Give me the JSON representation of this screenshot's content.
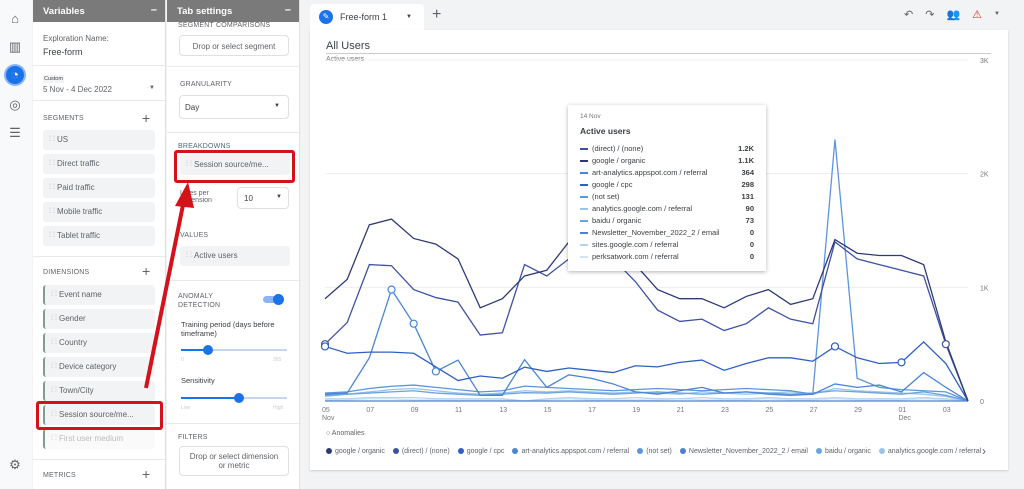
{
  "rail": {
    "icons": [
      "home-icon",
      "reports-icon",
      "explore-icon",
      "advertising-icon",
      "configure-icon",
      "settings-icon"
    ]
  },
  "variables": {
    "title": "Variables",
    "exploration_label": "Exploration Name:",
    "exploration_name": "Free-form",
    "date_tag": "Custom",
    "date_range": "5 Nov - 4 Dec 2022",
    "segments_label": "SEGMENTS",
    "segments": [
      "US",
      "Direct traffic",
      "Paid traffic",
      "Mobile traffic",
      "Tablet traffic"
    ],
    "dimensions_label": "DIMENSIONS",
    "dimensions": [
      "Event name",
      "Gender",
      "Country",
      "Device category",
      "Town/City",
      "Session source/me...",
      "First user medium"
    ],
    "metrics_label": "METRICS"
  },
  "tab_settings": {
    "title": "Tab settings",
    "segment_comparisons": "SEGMENT COMPARISONS",
    "segment_drop": "Drop or select segment",
    "granularity_label": "GRANULARITY",
    "granularity": "Day",
    "breakdowns_label": "BREAKDOWNS",
    "breakdown": "Session source/me...",
    "lines_label": "Lines per dimension",
    "lines": "10",
    "values_label": "VALUES",
    "value": "Active users",
    "anomaly_label": "ANOMALY DETECTION",
    "anomaly_on": true,
    "training_label": "Training period (days before timeframe)",
    "training_min": "0",
    "training_max": "365",
    "training_value": 0.25,
    "sensitivity_label": "Sensitivity",
    "sens_min": "Low",
    "sens_max": "High",
    "sensitivity_value": 0.55,
    "filters_label": "FILTERS",
    "filters_drop": "Drop or select dimension or metric"
  },
  "tabs": {
    "active": "Free-form 1",
    "add": "+"
  },
  "toolbar": {
    "icons": [
      "undo-icon",
      "redo-icon",
      "share-icon",
      "warning-icon"
    ]
  },
  "card": {
    "title": "All Users",
    "metric": "Active users",
    "anomalies": "Anomalies",
    "next": "›"
  },
  "tooltip": {
    "date": "14 Nov",
    "title": "Active users",
    "rows": [
      {
        "label": "(direct) / (none)",
        "value": "1.2K",
        "color": "#3f51a3"
      },
      {
        "label": "google / organic",
        "value": "1.1K",
        "color": "#2e3a78"
      },
      {
        "label": "art-analytics.appspot.com / referral",
        "value": "364",
        "color": "#4a85d6"
      },
      {
        "label": "google / cpc",
        "value": "298",
        "color": "#2f5fc4"
      },
      {
        "label": "(not set)",
        "value": "131",
        "color": "#5b95e0"
      },
      {
        "label": "analytics.google.com / referral",
        "value": "90",
        "color": "#9ac4e8"
      },
      {
        "label": "baidu / organic",
        "value": "73",
        "color": "#6aa4dc"
      },
      {
        "label": "Newsletter_November_2022_2 / email",
        "value": "0",
        "color": "#4f7fd0"
      },
      {
        "label": "sites.google.com / referral",
        "value": "0",
        "color": "#b5d3ee"
      },
      {
        "label": "perksatwork.com / referral",
        "value": "0",
        "color": "#d3e4f5"
      }
    ]
  },
  "chart_data": {
    "type": "line",
    "ylim": [
      0,
      3000
    ],
    "y_ticks": [
      "0",
      "1K",
      "2K",
      "3K"
    ],
    "x_ticks": [
      "05\nNov",
      "07",
      "09",
      "11",
      "13",
      "15",
      "17",
      "19",
      "21",
      "23",
      "25",
      "27",
      "29",
      "01\nDec",
      "03"
    ],
    "x": [
      "5 Nov",
      "6 Nov",
      "7 Nov",
      "8 Nov",
      "9 Nov",
      "10 Nov",
      "11 Nov",
      "12 Nov",
      "13 Nov",
      "14 Nov",
      "15 Nov",
      "16 Nov",
      "17 Nov",
      "18 Nov",
      "19 Nov",
      "20 Nov",
      "21 Nov",
      "22 Nov",
      "23 Nov",
      "24 Nov",
      "25 Nov",
      "26 Nov",
      "27 Nov",
      "28 Nov",
      "29 Nov",
      "30 Nov",
      "1 Dec",
      "2 Dec",
      "3 Dec",
      "4 Dec"
    ],
    "series": [
      {
        "name": "google / organic",
        "color": "#2e3a78",
        "values": [
          900,
          1070,
          1550,
          1600,
          1430,
          1380,
          1250,
          820,
          900,
          1100,
          1150,
          1400,
          1350,
          1320,
          1200,
          980,
          900,
          900,
          820,
          920,
          980,
          850,
          900,
          1420,
          1300,
          1280,
          1280,
          1200,
          520,
          0
        ]
      },
      {
        "name": "(direct) / (none)",
        "color": "#3f51a3",
        "values": [
          500,
          690,
          1200,
          1190,
          980,
          910,
          870,
          580,
          600,
          1200,
          1100,
          1250,
          1200,
          1250,
          1050,
          800,
          700,
          720,
          620,
          680,
          820,
          720,
          680,
          1400,
          1250,
          1200,
          1150,
          1100,
          500,
          0
        ]
      },
      {
        "name": "google / cpc",
        "color": "#2f5fc4",
        "values": [
          480,
          420,
          430,
          430,
          420,
          300,
          180,
          220,
          200,
          298,
          260,
          290,
          270,
          250,
          310,
          300,
          340,
          360,
          270,
          330,
          380,
          380,
          350,
          480,
          380,
          330,
          340,
          520,
          330,
          0
        ]
      },
      {
        "name": "art-analytics.appspot.com / referral",
        "color": "#4a85d6",
        "values": [
          60,
          70,
          380,
          980,
          680,
          260,
          360,
          50,
          50,
          364,
          120,
          230,
          200,
          150,
          80,
          60,
          90,
          120,
          70,
          80,
          60,
          50,
          60,
          150,
          120,
          140,
          80,
          250,
          120,
          0
        ]
      },
      {
        "name": "(not set)",
        "color": "#5b95e0",
        "values": [
          70,
          80,
          110,
          130,
          140,
          120,
          100,
          80,
          90,
          131,
          120,
          110,
          100,
          90,
          100,
          110,
          100,
          90,
          100,
          110,
          100,
          90,
          60,
          2300,
          200,
          120,
          100,
          90,
          80,
          0
        ]
      },
      {
        "name": "Newsletter_November_2022_2 / email",
        "color": "#4f7fd0",
        "values": [
          0,
          0,
          0,
          0,
          0,
          0,
          0,
          0,
          0,
          0,
          0,
          0,
          0,
          0,
          0,
          0,
          0,
          0,
          0,
          0,
          0,
          0,
          0,
          0,
          0,
          0,
          0,
          0,
          0,
          0
        ]
      },
      {
        "name": "baidu / organic",
        "color": "#6aa4dc",
        "values": [
          50,
          60,
          70,
          80,
          90,
          70,
          60,
          50,
          60,
          73,
          70,
          80,
          70,
          60,
          70,
          80,
          70,
          60,
          70,
          80,
          70,
          60,
          70,
          90,
          80,
          70,
          60,
          80,
          50,
          0
        ]
      },
      {
        "name": "analytics.google.com / referral",
        "color": "#9ac4e8",
        "values": [
          40,
          60,
          80,
          100,
          110,
          90,
          70,
          60,
          70,
          90,
          80,
          90,
          80,
          70,
          80,
          70,
          60,
          80,
          70,
          60,
          70,
          80,
          60,
          110,
          90,
          80,
          70,
          60,
          40,
          0
        ]
      },
      {
        "name": "sites.google.com / referral",
        "color": "#b5d3ee",
        "values": [
          20,
          20,
          30,
          30,
          30,
          20,
          20,
          20,
          20,
          0,
          20,
          30,
          20,
          20,
          30,
          20,
          20,
          30,
          20,
          20,
          30,
          20,
          20,
          30,
          20,
          20,
          20,
          30,
          20,
          0
        ]
      },
      {
        "name": "perksatwork.com / referral",
        "color": "#d3e4f5",
        "values": [
          10,
          10,
          20,
          20,
          10,
          10,
          10,
          10,
          10,
          0,
          10,
          20,
          10,
          10,
          10,
          10,
          20,
          10,
          10,
          10,
          20,
          10,
          10,
          20,
          10,
          10,
          10,
          20,
          10,
          0
        ]
      }
    ],
    "anomalies": [
      {
        "series": "(direct) / (none)",
        "x": "5 Nov"
      },
      {
        "series": "google / cpc",
        "x": "5 Nov"
      },
      {
        "series": "art-analytics.appspot.com / referral",
        "x": "8 Nov"
      },
      {
        "series": "art-analytics.appspot.com / referral",
        "x": "9 Nov"
      },
      {
        "series": "art-analytics.appspot.com / referral",
        "x": "10 Nov"
      },
      {
        "series": "google / cpc",
        "x": "1 Dec"
      },
      {
        "series": "google / cpc",
        "x": "28 Nov"
      },
      {
        "series": "(direct) / (none)",
        "x": "3 Dec"
      }
    ],
    "legend_placement": "bottom"
  }
}
